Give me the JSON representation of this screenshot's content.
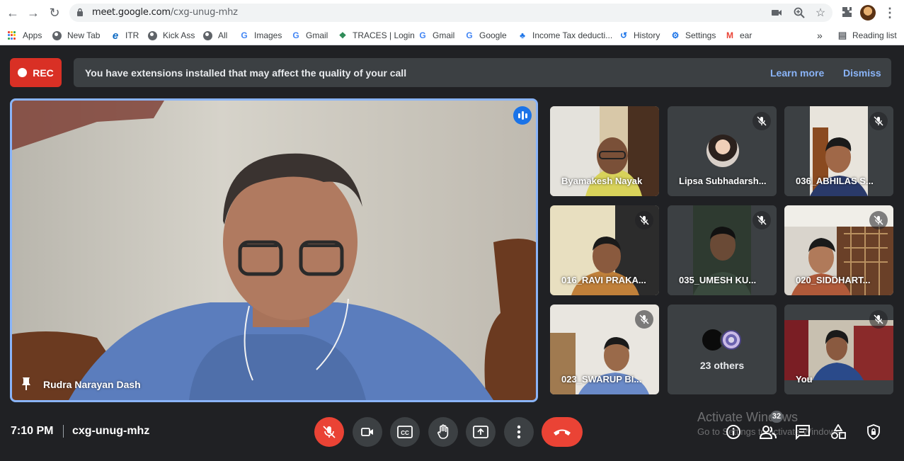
{
  "browser": {
    "url_host": "meet.google.com",
    "url_path": "/cxg-unug-mhz",
    "bookmarks": [
      {
        "label": "Apps",
        "icon": "apps-grid-icon"
      },
      {
        "label": "New Tab",
        "icon": "globe-icon"
      },
      {
        "label": "ITR",
        "icon": "edge-icon"
      },
      {
        "label": "Kick Ass",
        "icon": "globe-icon"
      },
      {
        "label": "All",
        "icon": "globe-icon"
      },
      {
        "label": "Images",
        "icon": "google-icon"
      },
      {
        "label": "Gmail",
        "icon": "google-icon"
      },
      {
        "label": "TRACES | Login",
        "icon": "traces-icon"
      },
      {
        "label": "Gmail",
        "icon": "google-icon"
      },
      {
        "label": "Google",
        "icon": "google-icon"
      },
      {
        "label": "Income Tax deducti...",
        "icon": "income-tax-icon"
      },
      {
        "label": "History",
        "icon": "history-icon"
      },
      {
        "label": "Settings",
        "icon": "gear-icon"
      },
      {
        "label": "ear",
        "icon": "gmail-icon"
      }
    ],
    "overflow": "»",
    "reading_list": "Reading list"
  },
  "meet": {
    "rec_label": "REC",
    "banner": {
      "message": "You have extensions installed that may affect the quality of your call",
      "learn_more": "Learn more",
      "dismiss": "Dismiss"
    },
    "main_speaker": "Rudra Narayan Dash",
    "tiles": [
      {
        "name": "Byamakesh Nayak",
        "muted": false
      },
      {
        "name": "Lipsa Subhadarsh...",
        "muted": true
      },
      {
        "name": "036_ABHILAS S...",
        "muted": true
      },
      {
        "name": "016_RAVI PRAKA...",
        "muted": true
      },
      {
        "name": "035_UMESH KU...",
        "muted": true
      },
      {
        "name": "020_SIDDHART...",
        "muted": true
      },
      {
        "name": "023_SWARUP BI...",
        "muted": true
      },
      {
        "name": "23 others",
        "muted": false
      },
      {
        "name": "You",
        "muted": true
      }
    ],
    "time": "7:10 PM",
    "meeting_code": "cxg-unug-mhz",
    "people_count": "32",
    "watermark_title": "Activate Windows",
    "watermark_sub": "Go to Settings to activate Windows."
  },
  "colors": {
    "meet_bg": "#202124",
    "rec_red": "#d93025",
    "link_blue": "#8ab4f8",
    "end_call_red": "#ea4335",
    "speaking_blue": "#1a73e8"
  }
}
